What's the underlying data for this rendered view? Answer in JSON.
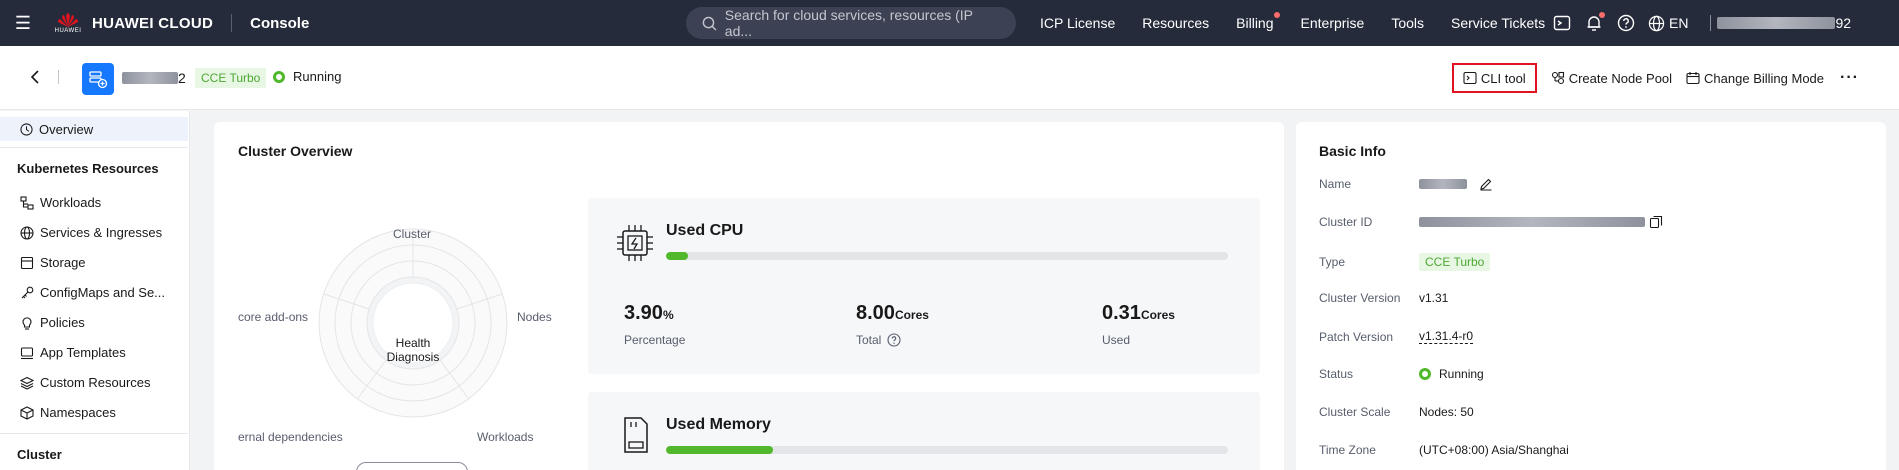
{
  "topnav": {
    "brand": "HUAWEI CLOUD",
    "brand_sub": "HUAWEI",
    "console": "Console",
    "search_placeholder": "Search for cloud services, resources (IP ad...",
    "links": [
      {
        "label": "ICP License"
      },
      {
        "label": "Resources"
      },
      {
        "label": "Billing"
      },
      {
        "label": "Enterprise"
      },
      {
        "label": "Tools"
      },
      {
        "label": "Service Tickets"
      }
    ],
    "lang": "EN",
    "user_suffix": "92",
    "alert_color": "#fa6b6b"
  },
  "subheader": {
    "cluster_name_suffix": "2",
    "type_tag": "CCE Turbo",
    "status": "Running",
    "actions": {
      "cli": "CLI tool",
      "create_pool": "Create Node Pool",
      "billing_mode": "Change Billing Mode",
      "more": "···"
    },
    "highlight_color": "#e0141f"
  },
  "sidebar": {
    "overview": "Overview",
    "group_k8s": "Kubernetes Resources",
    "items": [
      {
        "label": "Workloads",
        "icon": "workloads-icon"
      },
      {
        "label": "Services & Ingresses",
        "icon": "globe-icon"
      },
      {
        "label": "Storage",
        "icon": "storage-icon"
      },
      {
        "label": "ConfigMaps and Se...",
        "icon": "key-icon"
      },
      {
        "label": "Policies",
        "icon": "bulb-icon"
      },
      {
        "label": "App Templates",
        "icon": "template-icon"
      },
      {
        "label": "Custom Resources",
        "icon": "layers-icon"
      },
      {
        "label": "Namespaces",
        "icon": "cube-icon"
      }
    ],
    "group_cluster": "Cluster"
  },
  "overview": {
    "title": "Cluster Overview",
    "radar_labels": {
      "top": "Cluster",
      "right": "Nodes",
      "left": "core add-ons",
      "bottom_left": "ernal dependencies",
      "bottom_right": "Workloads"
    },
    "health": "Health Diagnosis"
  },
  "cpu": {
    "title": "Used CPU",
    "fill_fraction": 0.039,
    "percentage": {
      "value": "3.90",
      "unit": "%",
      "label": "Percentage"
    },
    "total": {
      "value": "8.00",
      "unit": "Cores",
      "label": "Total"
    },
    "used": {
      "value": "0.31",
      "unit": "Cores",
      "label": "Used"
    }
  },
  "memory": {
    "title": "Used Memory",
    "fill_fraction": 0.19
  },
  "basic_info": {
    "title": "Basic Info",
    "rows": {
      "name": {
        "label": "Name"
      },
      "cluster_id": {
        "label": "Cluster ID"
      },
      "type": {
        "label": "Type",
        "value": "CCE Turbo"
      },
      "version": {
        "label": "Cluster Version",
        "value": "v1.31"
      },
      "patch": {
        "label": "Patch Version",
        "value": "v1.31.4-r0"
      },
      "status": {
        "label": "Status",
        "value": "Running"
      },
      "scale": {
        "label": "Cluster Scale",
        "value": "Nodes: 50"
      },
      "timezone": {
        "label": "Time Zone",
        "value": "(UTC+08:00) Asia/Shanghai"
      }
    }
  },
  "colors": {
    "nav_bg": "#252b3a",
    "accent_green": "#50b82a",
    "brand_blue": "#1677ff"
  }
}
